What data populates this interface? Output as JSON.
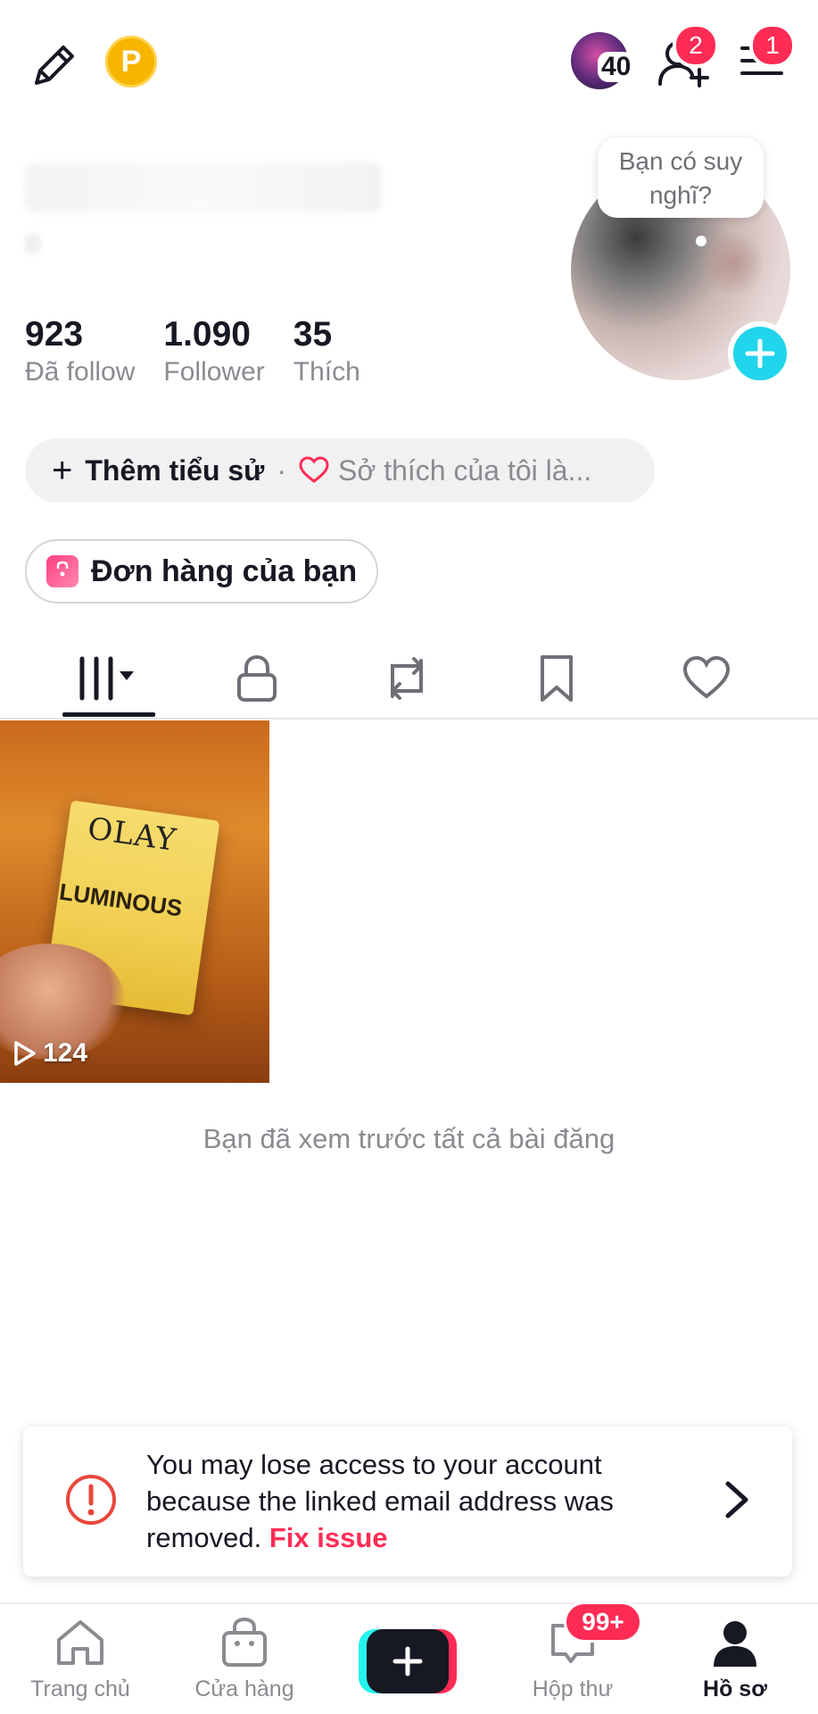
{
  "topbar": {
    "coin_letter": "P",
    "story_count": "40",
    "friend_badge": "2",
    "menu_badge": "1"
  },
  "profile": {
    "thought_bubble": "Bạn có suy nghĩ?",
    "stats": [
      {
        "value": "923",
        "label": "Đã follow"
      },
      {
        "value": "1.090",
        "label": "Follower"
      },
      {
        "value": "35",
        "label": "Thích"
      }
    ],
    "bio_add": "Thêm tiểu sử",
    "bio_separator": "·",
    "bio_interest": "Sở thích của tôi là...",
    "orders_label": "Đơn hàng của bạn"
  },
  "tabs": [
    "videos-grid-icon",
    "lock-icon",
    "repost-icon",
    "bookmark-icon",
    "heart-icon"
  ],
  "video": {
    "brand": "OLAY",
    "product": "LUMINOUS",
    "views": "124"
  },
  "end_text": "Bạn đã xem trước tất cả bài đăng",
  "warning": {
    "text": "You may lose access to your account because the linked email address was removed.",
    "link": "Fix issue"
  },
  "nav": {
    "home": "Trang chủ",
    "shop": "Cửa hàng",
    "inbox": "Hộp thư",
    "inbox_badge": "99+",
    "profile": "Hồ sơ"
  },
  "colors": {
    "accent_red": "#fe2c55",
    "accent_cyan": "#25f4ee",
    "add_blue": "#20d5ec",
    "coin": "#f7b500"
  }
}
